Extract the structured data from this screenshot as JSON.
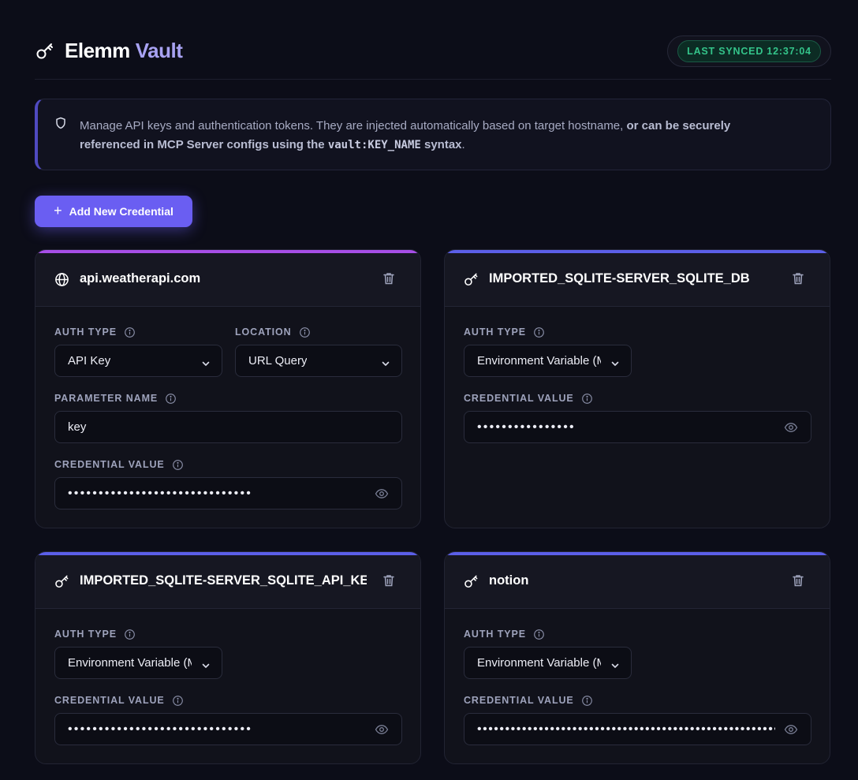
{
  "app": {
    "title": "Elemm",
    "title_accent": "Vault",
    "sync_status": "LAST SYNCED 12:37:04"
  },
  "notice": {
    "text_plain": "Manage API keys and authentication tokens. They are injected automatically based on target hostname, ",
    "text_bold_1": "or can be securely referenced in MCP Server configs using the ",
    "code": "vault:KEY_NAME",
    "text_bold_2": " syntax",
    "text_end": "."
  },
  "actions": {
    "add_label": "Add New Credential"
  },
  "colors": {
    "accent": "#6a5ef2",
    "bar_purple": "#a64ee6",
    "bar_indigo": "#5b5fe8",
    "sync_green": "#34c48a"
  },
  "credentials": [
    {
      "title": "api.weatherapi.com",
      "icon": "globe-icon",
      "auth_type_label": "AUTH TYPE",
      "auth_type": "API Key",
      "location_label": "LOCATION",
      "location": "URL Query",
      "param_label": "PARAMETER NAME",
      "param_name": "key",
      "value_label": "CREDENTIAL VALUE",
      "value_masked": "••••••••••••••••••••••••••••••"
    },
    {
      "title": "IMPORTED_SQLITE-SERVER_SQLITE_DB",
      "icon": "key-icon",
      "auth_type_label": "AUTH TYPE",
      "auth_type": "Environment Variable (MCP)",
      "value_label": "CREDENTIAL VALUE",
      "value_masked": "••••••••••••••••"
    },
    {
      "title": "IMPORTED_SQLITE-SERVER_SQLITE_API_KEY",
      "icon": "key-icon",
      "auth_type_label": "AUTH TYPE",
      "auth_type": "Environment Variable (MCP)",
      "value_label": "CREDENTIAL VALUE",
      "value_masked": "••••••••••••••••••••••••••••••"
    },
    {
      "title": "notion",
      "icon": "key-icon",
      "auth_type_label": "AUTH TYPE",
      "auth_type": "Environment Variable (MCP)",
      "value_label": "CREDENTIAL VALUE",
      "value_masked": "••••••••••••••••••••••••••••••••••••••••••••••••••••••"
    }
  ]
}
